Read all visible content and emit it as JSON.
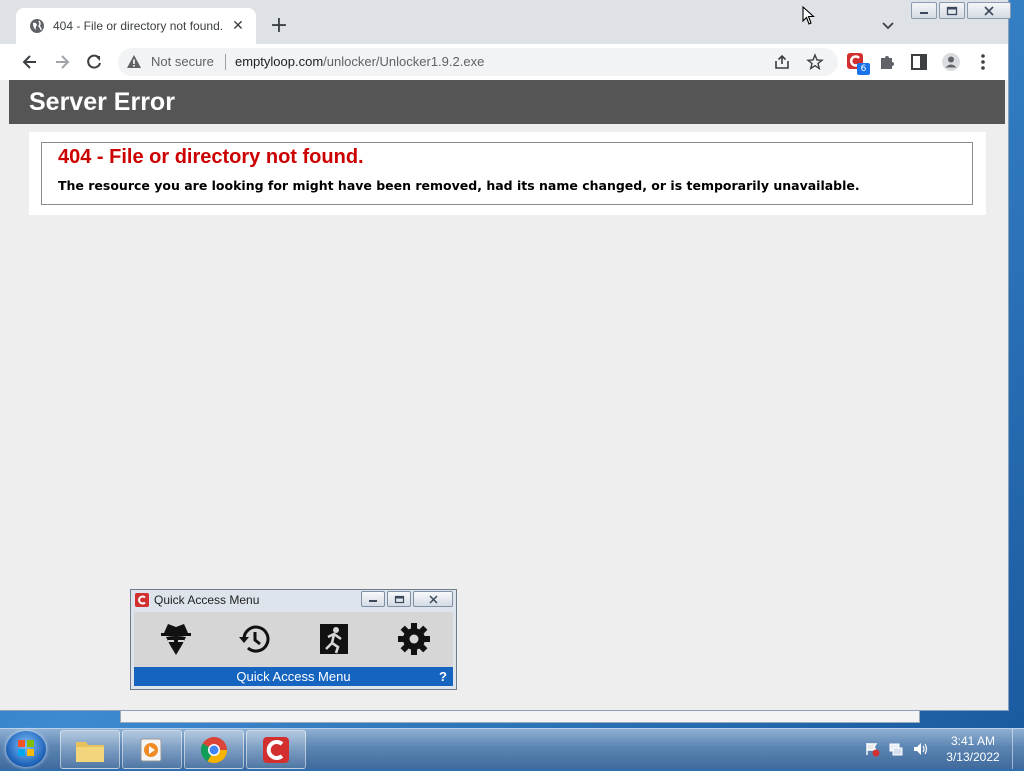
{
  "browser": {
    "tab_title": "404 - File or directory not found.",
    "new_tab_symbol": "+",
    "tab_close_symbol": "✕",
    "security_label": "Not secure",
    "url_host": "emptyloop.com",
    "url_path": "/unlocker/Unlocker1.9.2.exe",
    "extension_badge": "6"
  },
  "page": {
    "header": "Server Error",
    "error_title": "404 - File or directory not found.",
    "error_description": "The resource you are looking for might have been removed, had its name changed, or is temporarily unavailable."
  },
  "quick_access": {
    "title": "Quick Access Menu",
    "footer": "Quick Access Menu",
    "help": "?",
    "icons": [
      "incognito-icon",
      "history-icon",
      "exit-icon",
      "settings-icon"
    ]
  },
  "taskbar": {
    "time": "3:41 AM",
    "date": "3/13/2022",
    "pinned": [
      "file-explorer-icon",
      "media-player-icon",
      "chrome-icon",
      "ccleaner-icon"
    ]
  },
  "colors": {
    "error_red": "#cc0000",
    "header_bg": "#555555",
    "qam_footer_bg": "#1565c0"
  }
}
